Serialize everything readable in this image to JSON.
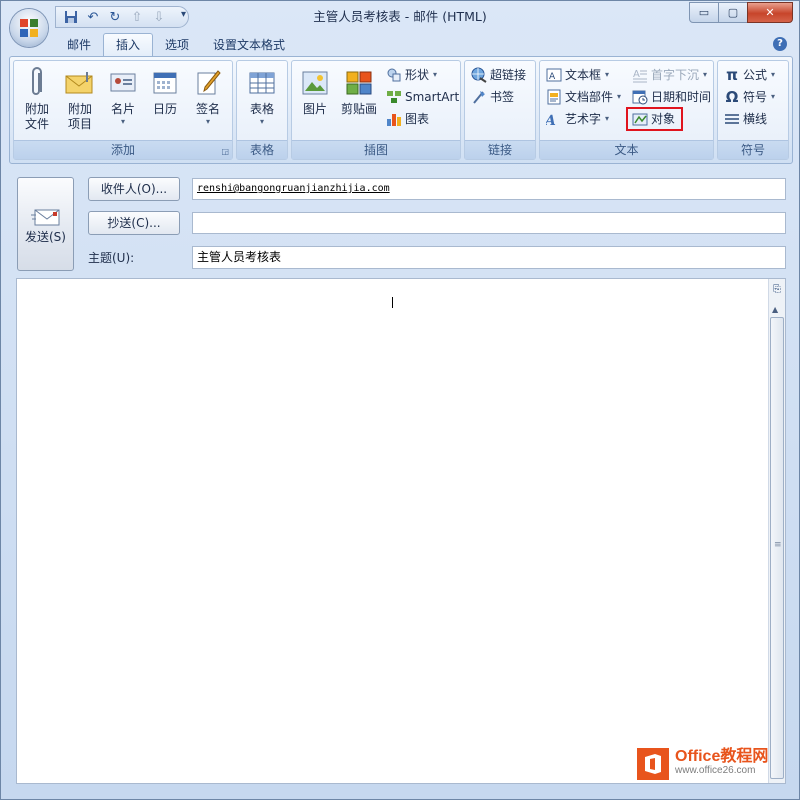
{
  "window": {
    "title": "主管人员考核表 - 邮件 (HTML)",
    "controls": {
      "minimize": "▭",
      "maximize": "▢",
      "close": "✕"
    }
  },
  "qat": {
    "more": "▾"
  },
  "tabs": [
    {
      "label": "邮件",
      "active": false
    },
    {
      "label": "插入",
      "active": true
    },
    {
      "label": "选项",
      "active": false
    },
    {
      "label": "设置文本格式",
      "active": false
    }
  ],
  "help": "?",
  "ribbon": {
    "add": {
      "title": "添加",
      "attach_file": "附加\n文件",
      "attach_item": "附加\n项目",
      "business_card": "名片",
      "calendar": "日历",
      "signature": "签名"
    },
    "tables": {
      "title": "表格",
      "table": "表格"
    },
    "illustrations": {
      "title": "插图",
      "picture": "图片",
      "clipart": "剪贴画",
      "shapes": "形状",
      "smartart": "SmartArt",
      "chart": "图表"
    },
    "links": {
      "title": "链接",
      "hyperlink": "超链接",
      "bookmark": "书签"
    },
    "text": {
      "title": "文本",
      "textbox": "文本框",
      "quickparts": "文档部件",
      "wordart": "艺术字",
      "dropcap": "首字下沉",
      "datetime": "日期和时间",
      "object": "对象"
    },
    "symbols": {
      "title": "符号",
      "equation": "公式",
      "symbol": "符号",
      "hline": "横线"
    }
  },
  "compose": {
    "send": "发送(S)",
    "to_button": "收件人(O)...",
    "cc_button": "抄送(C)...",
    "subject_label": "主题(U):",
    "to_value": "renshi@bangongruanjianzhijia.com",
    "cc_value": "",
    "subject_value": "主管人员考核表",
    "body_text": ""
  },
  "watermark": {
    "line1": "Office教程网",
    "line2": "www.office26.com"
  }
}
